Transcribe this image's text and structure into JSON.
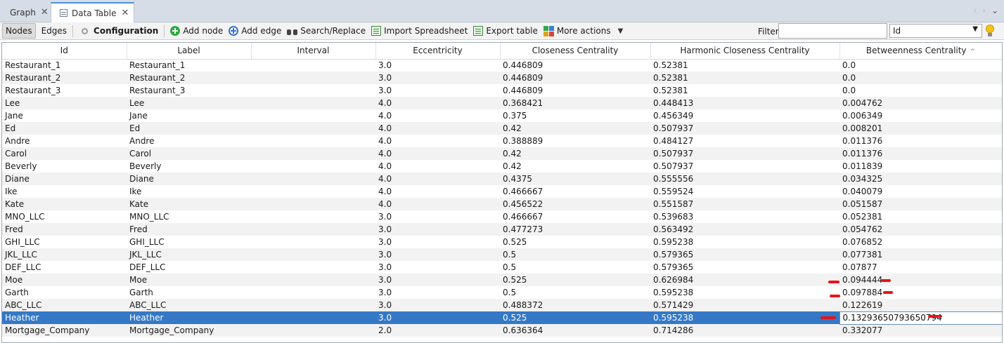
{
  "tabs": [
    {
      "label": "Graph",
      "active": false
    },
    {
      "label": "Data Table",
      "active": true
    }
  ],
  "toolbar": {
    "nodes_label": "Nodes",
    "edges_label": "Edges",
    "configuration_label": "Configuration",
    "add_node_label": "Add node",
    "add_edge_label": "Add edge",
    "search_replace_label": "Search/Replace",
    "import_label": "Import Spreadsheet",
    "export_label": "Export table",
    "more_label": "More actions",
    "filter_label": "Filter:",
    "filter_value": "",
    "filter_column": "Id"
  },
  "table": {
    "columns": [
      "Id",
      "Label",
      "Interval",
      "Eccentricity",
      "Closeness Centrality",
      "Harmonic Closeness Centrality",
      "Betweenness Centrality"
    ],
    "sorted_column": "Betweenness Centrality",
    "rows": [
      [
        "Restaurant_1",
        "Restaurant_1",
        "",
        "3.0",
        "0.446809",
        "0.52381",
        "0.0"
      ],
      [
        "Restaurant_2",
        "Restaurant_2",
        "",
        "3.0",
        "0.446809",
        "0.52381",
        "0.0"
      ],
      [
        "Restaurant_3",
        "Restaurant_3",
        "",
        "3.0",
        "0.446809",
        "0.52381",
        "0.0"
      ],
      [
        "Lee",
        "Lee",
        "",
        "4.0",
        "0.368421",
        "0.448413",
        "0.004762"
      ],
      [
        "Jane",
        "Jane",
        "",
        "4.0",
        "0.375",
        "0.456349",
        "0.006349"
      ],
      [
        "Ed",
        "Ed",
        "",
        "4.0",
        "0.42",
        "0.507937",
        "0.008201"
      ],
      [
        "Andre",
        "Andre",
        "",
        "4.0",
        "0.388889",
        "0.484127",
        "0.011376"
      ],
      [
        "Carol",
        "Carol",
        "",
        "4.0",
        "0.42",
        "0.507937",
        "0.011376"
      ],
      [
        "Beverly",
        "Beverly",
        "",
        "4.0",
        "0.42",
        "0.507937",
        "0.011839"
      ],
      [
        "Diane",
        "Diane",
        "",
        "4.0",
        "0.4375",
        "0.555556",
        "0.034325"
      ],
      [
        "Ike",
        "Ike",
        "",
        "4.0",
        "0.466667",
        "0.559524",
        "0.040079"
      ],
      [
        "Kate",
        "Kate",
        "",
        "4.0",
        "0.456522",
        "0.551587",
        "0.051587"
      ],
      [
        "MNO_LLC",
        "MNO_LLC",
        "",
        "3.0",
        "0.466667",
        "0.539683",
        "0.052381"
      ],
      [
        "Fred",
        "Fred",
        "",
        "3.0",
        "0.477273",
        "0.563492",
        "0.054762"
      ],
      [
        "GHI_LLC",
        "GHI_LLC",
        "",
        "3.0",
        "0.525",
        "0.595238",
        "0.076852"
      ],
      [
        "JKL_LLC",
        "JKL_LLC",
        "",
        "3.0",
        "0.5",
        "0.579365",
        "0.077381"
      ],
      [
        "DEF_LLC",
        "DEF_LLC",
        "",
        "3.0",
        "0.5",
        "0.579365",
        "0.07877"
      ],
      [
        "Moe",
        "Moe",
        "",
        "3.0",
        "0.525",
        "0.626984",
        "0.094444"
      ],
      [
        "Garth",
        "Garth",
        "",
        "3.0",
        "0.5",
        "0.595238",
        "0.097884"
      ],
      [
        "ABC_LLC",
        "ABC_LLC",
        "",
        "3.0",
        "0.488372",
        "0.571429",
        "0.122619"
      ],
      [
        "Heather",
        "Heather",
        "",
        "3.0",
        "0.525",
        "0.595238",
        "0.13293650793650794"
      ],
      [
        "Mortgage_Company",
        "Mortgage_Company",
        "",
        "2.0",
        "0.636364",
        "0.714286",
        "0.332077"
      ]
    ],
    "selected_row": 20
  },
  "colors": {
    "selection": "#3478c6",
    "annotation_marks": "#e8141b"
  }
}
